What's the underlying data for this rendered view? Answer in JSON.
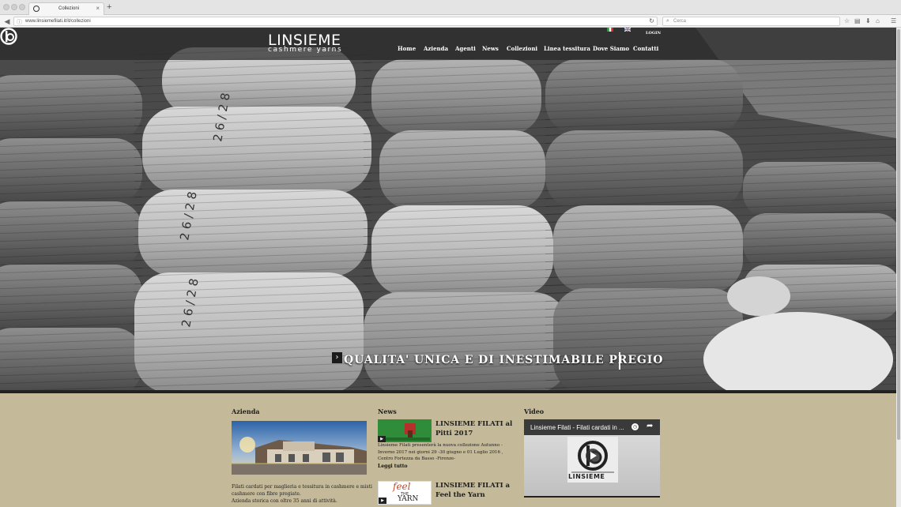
{
  "browser": {
    "tab_title": "Collezioni",
    "tab_close": "×",
    "new_tab": "+",
    "url": "www.linsiemefilati.it/it/collezioni",
    "search_placeholder": "Cerca",
    "icons": [
      "back-icon",
      "info-icon",
      "reload-icon",
      "search-icon",
      "star-icon",
      "bookmarks-icon",
      "download-icon",
      "home-icon",
      "menu-icon"
    ]
  },
  "site": {
    "logo_name": "LINSIEME",
    "logo_sub": "cashmere yarns",
    "login": "LOGIN",
    "flags": [
      "italian-flag-icon",
      "uk-flag-icon"
    ],
    "menu": [
      "Home",
      "Azienda",
      "Agenti",
      "News",
      "Collezioni",
      "Linea tessitura",
      "Dove Siamo",
      "Contatti"
    ],
    "slider": {
      "caption": "QUALITA' UNICA  E DI  INESTIMABILE PREGIO",
      "dot_count": 4,
      "active_dot": 4
    }
  },
  "sections": {
    "azienda": {
      "title": "Azienda",
      "text_1": "Filati cardati per maglieria e tessitura in cashmere e misti cashmere con fibre pregiate.",
      "text_2": "Azienda storica con oltre 35 anni di attività."
    },
    "news": {
      "title": "News",
      "items": [
        {
          "title": "LINSIEME FILATI al Pitti 2017",
          "body": "Linsieme Filati presenterà la nuova collezione Autunno - Inverno 2017 nei giorni 29 -30 giugno e 01 Luglio 2016 , Centro Fortezza da Basso -Firenze-",
          "more": "Leggi tutto"
        },
        {
          "title": "LINSIEME FILATI a Feel the Yarn",
          "thumb_text_1": "feel",
          "thumb_text_2": "THE",
          "thumb_text_3": "YARN"
        }
      ]
    },
    "video": {
      "title": "Video",
      "player_title": "Linsieme Filati - Filati cardati in ...",
      "player_logo": "LINSIEME"
    }
  },
  "colors": {
    "content_bg": "#c4b998",
    "header_band": "#282828",
    "text_dark": "#1d1d1d"
  }
}
